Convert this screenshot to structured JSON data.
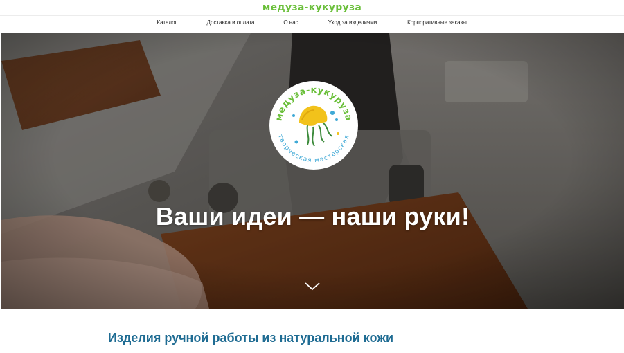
{
  "header": {
    "logo_text": "медуза-кукуруза",
    "logo_color": "#6abf3a"
  },
  "nav": {
    "items": [
      {
        "label": "Каталог"
      },
      {
        "label": "Доставка и оплата"
      },
      {
        "label": "О нас"
      },
      {
        "label": "Уход за изделиями"
      },
      {
        "label": "Корпоративные заказы"
      }
    ]
  },
  "hero": {
    "badge_top_text": "медуза-кукуруза",
    "badge_bottom_text": "творческая мастерская",
    "badge_top_color": "#6abf3a",
    "badge_bottom_color": "#3fa9d6",
    "jellyfish_color": "#f2c21b",
    "title": "Ваши идеи — наши руки!",
    "scroll_icon": "chevron-down-icon"
  },
  "main": {
    "section_heading": "Изделия ручной работы из натуральной кожи",
    "heading_color": "#1f6c93"
  }
}
